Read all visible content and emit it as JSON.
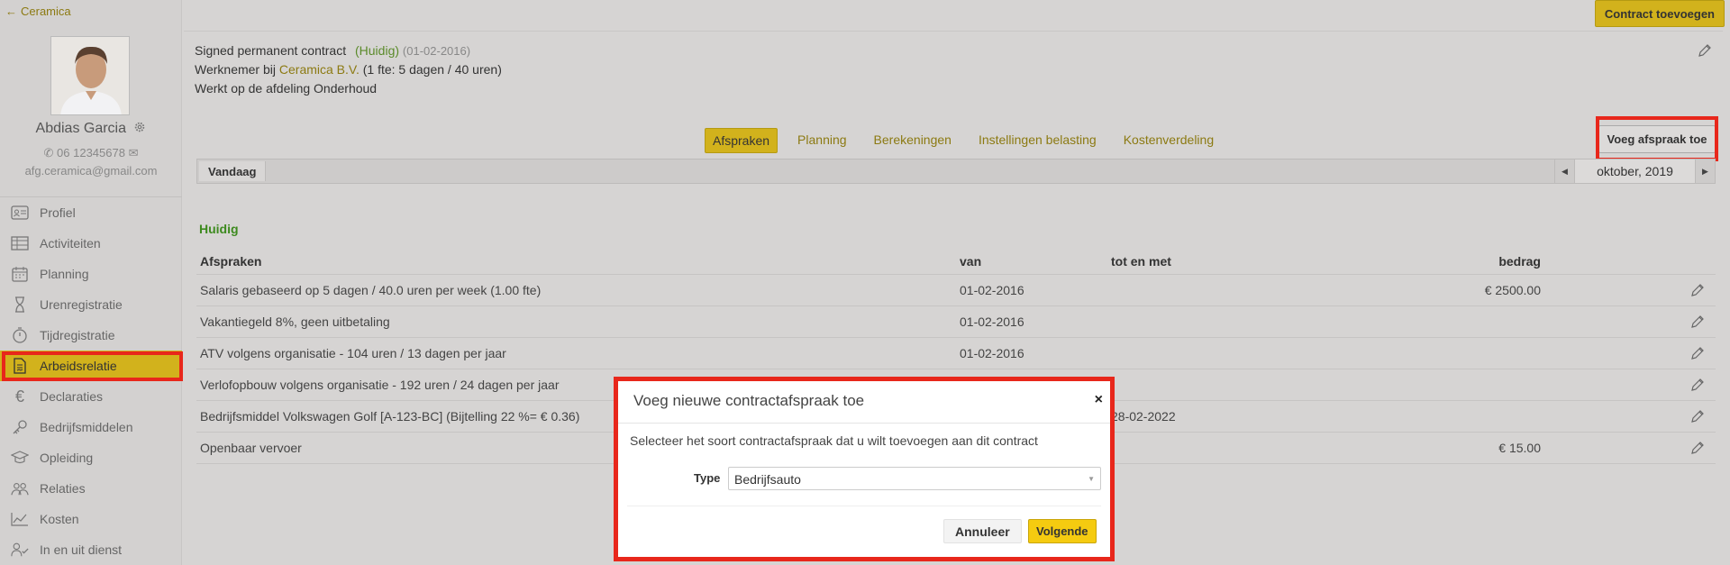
{
  "sidebar": {
    "back_label": "Ceramica",
    "user_name": "Abdias Garcia",
    "phone": "06 12345678",
    "email": "afg.ceramica@gmail.com",
    "items": [
      {
        "label": "Profiel",
        "icon": "id-card-icon"
      },
      {
        "label": "Activiteiten",
        "icon": "table-icon"
      },
      {
        "label": "Planning",
        "icon": "calendar-icon"
      },
      {
        "label": "Urenregistratie",
        "icon": "hourglass-icon"
      },
      {
        "label": "Tijdregistratie",
        "icon": "stopwatch-icon"
      },
      {
        "label": "Arbeidsrelatie",
        "icon": "contract-icon",
        "active": true
      },
      {
        "label": "Declaraties",
        "icon": "euro-icon"
      },
      {
        "label": "Bedrijfsmiddelen",
        "icon": "key-icon"
      },
      {
        "label": "Opleiding",
        "icon": "graduation-icon"
      },
      {
        "label": "Relaties",
        "icon": "people-icon"
      },
      {
        "label": "Kosten",
        "icon": "chart-icon"
      },
      {
        "label": "In en uit dienst",
        "icon": "user-check-icon"
      }
    ]
  },
  "header": {
    "add_contract_label": "Contract toevoegen"
  },
  "contract": {
    "title": "Signed permanent contract",
    "status": "(Huidig)",
    "date": "(01-02-2016)",
    "employer_prefix": "Werknemer bij",
    "company": "Ceramica B.V.",
    "fte": "(1 fte: 5 dagen / 40 uren)",
    "department": "Werkt op de afdeling Onderhoud"
  },
  "tabs": [
    "Afspraken",
    "Planning",
    "Berekeningen",
    "Instellingen belasting",
    "Kostenverdeling"
  ],
  "active_tab": "Afspraken",
  "add_agreement_label": "Voeg afspraak toe",
  "toolbar": {
    "today_label": "Vandaag",
    "month": "oktober, 2019"
  },
  "section_title": "Huidig",
  "table": {
    "headers": [
      "Afspraken",
      "van",
      "tot en met",
      "bedrag"
    ],
    "rows": [
      {
        "name": "Salaris gebaseerd op 5 dagen / 40.0 uren per week (1.00 fte)",
        "from": "01-02-2016",
        "to": "",
        "amount": "€ 2500.00"
      },
      {
        "name": "Vakantiegeld 8%, geen uitbetaling",
        "from": "01-02-2016",
        "to": "",
        "amount": ""
      },
      {
        "name": "ATV volgens organisatie - 104 uren / 13 dagen per jaar",
        "from": "01-02-2016",
        "to": "",
        "amount": ""
      },
      {
        "name": "Verlofopbouw volgens organisatie - 192 uren / 24 dagen per jaar",
        "from": "",
        "to": "",
        "amount": ""
      },
      {
        "name": "Bedrijfsmiddel Volkswagen Golf [A-123-BC] (Bijtelling 22 %= € 0.36)",
        "from": "",
        "to": "28-02-2022",
        "amount": ""
      },
      {
        "name": "Openbaar vervoer",
        "from": "",
        "to": "",
        "amount": "€ 15.00"
      }
    ]
  },
  "modal": {
    "title": "Voeg nieuwe contractafspraak toe",
    "close": "×",
    "text": "Selecteer het soort contractafspraak dat u wilt toevoegen aan dit contract",
    "type_label": "Type",
    "type_value": "Bedrijfsauto",
    "cancel_label": "Annuleer",
    "next_label": "Volgende"
  },
  "colors": {
    "accent": "#d2b21c",
    "highlight": "#e8271b",
    "status_green": "#3d8a1e"
  }
}
